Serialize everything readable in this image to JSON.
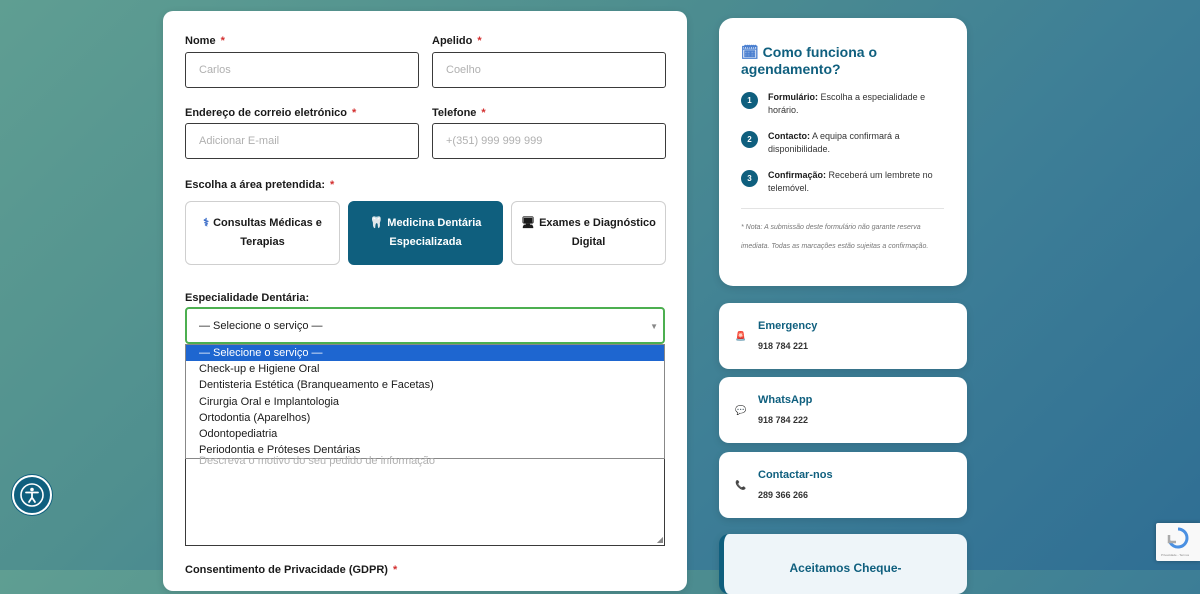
{
  "form": {
    "first_name": {
      "label": "Nome",
      "required_mark": "*",
      "placeholder": "Carlos"
    },
    "last_name": {
      "label": "Apelido",
      "required_mark": "*",
      "placeholder": "Coelho"
    },
    "email": {
      "label": "Endereço de correio eletrónico",
      "required_mark": "*",
      "placeholder": "Adicionar E-mail"
    },
    "phone": {
      "label": "Telefone",
      "required_mark": "*",
      "placeholder": "+(351) 999 999 999"
    },
    "area": {
      "label": "Escolha a área pretendida:",
      "required_mark": "*",
      "options": [
        {
          "icon": "stethoscope-icon",
          "glyph": "⚕",
          "label": "Consultas Médicas e Terapias",
          "active": false
        },
        {
          "icon": "tooth-icon",
          "glyph": "🦷",
          "label": "Medicina Dentária Especializada",
          "active": true
        },
        {
          "icon": "monitor-icon",
          "glyph": "🖥",
          "label": "Exames e Diagnóstico Digital",
          "active": false
        }
      ]
    },
    "specialty": {
      "label": "Especialidade Dentária:",
      "selected": "— Selecione o serviço —",
      "options": [
        "— Selecione o serviço —",
        "Check-up e Higiene Oral",
        "Dentisteria Estética (Branqueamento e Facetas)",
        "Cirurgia Oral e Implantologia",
        "Ortodontia (Aparelhos)",
        "Odontopediatria",
        "Periodontia e Próteses Dentárias"
      ],
      "highlighted_index": 0
    },
    "message": {
      "placeholder": "Descreva o motivo do seu pedido de informação"
    },
    "privacy": {
      "label": "Consentimento de Privacidade (GDPR)",
      "required_mark": "*"
    }
  },
  "how_it_works": {
    "icon": "calendar-icon",
    "title": "Como funciona o agendamento?",
    "steps": [
      {
        "num": "1",
        "bold": "Formulário:",
        "text": "Escolha a especialidade e horário."
      },
      {
        "num": "2",
        "bold": "Contacto:",
        "text": "A equipa confirmará a disponibilidade."
      },
      {
        "num": "3",
        "bold": "Confirmação:",
        "text": "Receberá um lembrete no telemóvel."
      }
    ],
    "note": "* Nota: A submissão deste formulário não garante reserva imediata. Todas as marcações estão sujeitas a confirmação."
  },
  "contacts": [
    {
      "icon": "alarm-icon",
      "glyph": "🚨",
      "title": "Emergency",
      "value": "918 784 221"
    },
    {
      "icon": "chat-icon",
      "glyph": "💬",
      "title": "WhatsApp",
      "value": "918 784 222"
    },
    {
      "icon": "phone-icon",
      "glyph": "📞",
      "title": "Contactar-nos",
      "value": "289 366 266"
    }
  ],
  "cheque": {
    "title": "Aceitamos Cheque-"
  },
  "recaptcha": {
    "text": "Privacidade - Termos"
  },
  "colors": {
    "accent": "#0f5f7e",
    "select_border": "#4caf50",
    "highlight": "#1e66d0",
    "required": "#d32f2f"
  }
}
